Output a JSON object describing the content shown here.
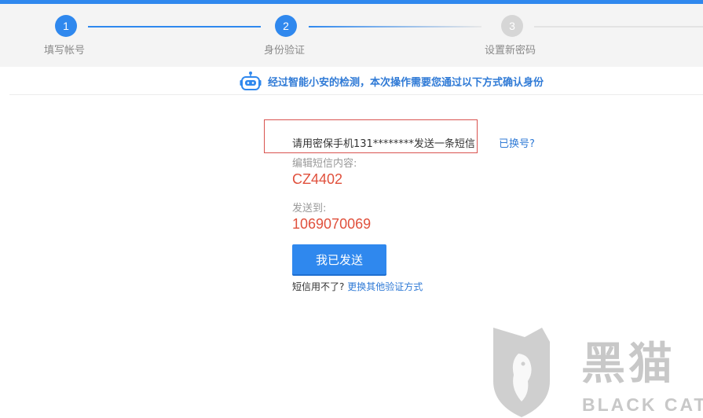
{
  "steps": [
    {
      "number": "1",
      "label": "填写帐号",
      "state": "done"
    },
    {
      "number": "2",
      "label": "身份验证",
      "state": "active"
    },
    {
      "number": "3",
      "label": "设置新密码",
      "state": "pending"
    }
  ],
  "notice": {
    "icon": "robot-icon",
    "text": "经过智能小安的检测，本次操作需要您通过以下方式确认身份"
  },
  "verify": {
    "send_instruction": "请用密保手机131********发送一条短信",
    "change_number_link": "已换号?",
    "content_label": "编辑短信内容:",
    "content_value": "CZ4402",
    "send_to_label": "发送到:",
    "send_to_value": "1069070069",
    "confirm_button": "我已发送",
    "help_prefix": "短信用不了?",
    "help_link": "更换其他验证方式"
  },
  "watermark": {
    "cn": "黑猫",
    "en": "BLACK CAT"
  },
  "colors": {
    "accent": "#2f88ee",
    "highlight_value": "#e0503c",
    "annotation_box": "#d9534f"
  }
}
